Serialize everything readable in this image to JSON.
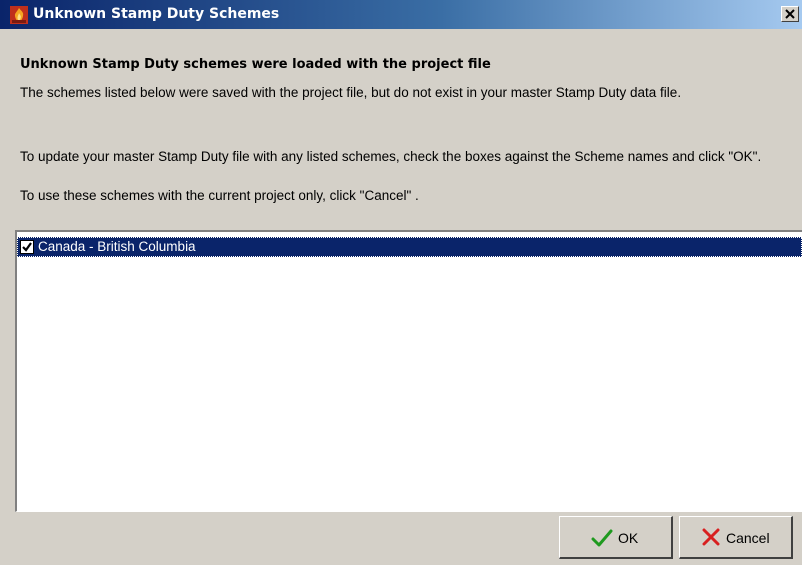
{
  "window": {
    "title": "Unknown Stamp Duty Schemes",
    "title_icon": "app-flame-icon",
    "close_icon": "close-icon"
  },
  "content": {
    "heading": "Unknown Stamp Duty schemes were loaded with the project file",
    "paragraph_1": "The schemes listed below were saved with the project file, but do not exist in your master Stamp Duty data file.",
    "paragraph_2": "To update your master Stamp Duty file with any listed schemes, check the boxes against the Scheme names and click \"OK\".",
    "paragraph_3": "To use these schemes with the current project only, click \"Cancel\" ."
  },
  "schemes": [
    {
      "label": "Canada - British Columbia",
      "checked": true,
      "selected": true
    }
  ],
  "buttons": {
    "ok_label": "OK",
    "ok_icon": "checkmark-icon",
    "cancel_label": "Cancel",
    "cancel_icon": "x-icon"
  },
  "colors": {
    "title_bar_start": "#0a246a",
    "title_bar_end": "#a6caf0",
    "dialog_background": "#d4d0c8",
    "selection_background": "#0a246a",
    "ok_icon_color": "#1f9a1f",
    "cancel_icon_color": "#d82020"
  }
}
